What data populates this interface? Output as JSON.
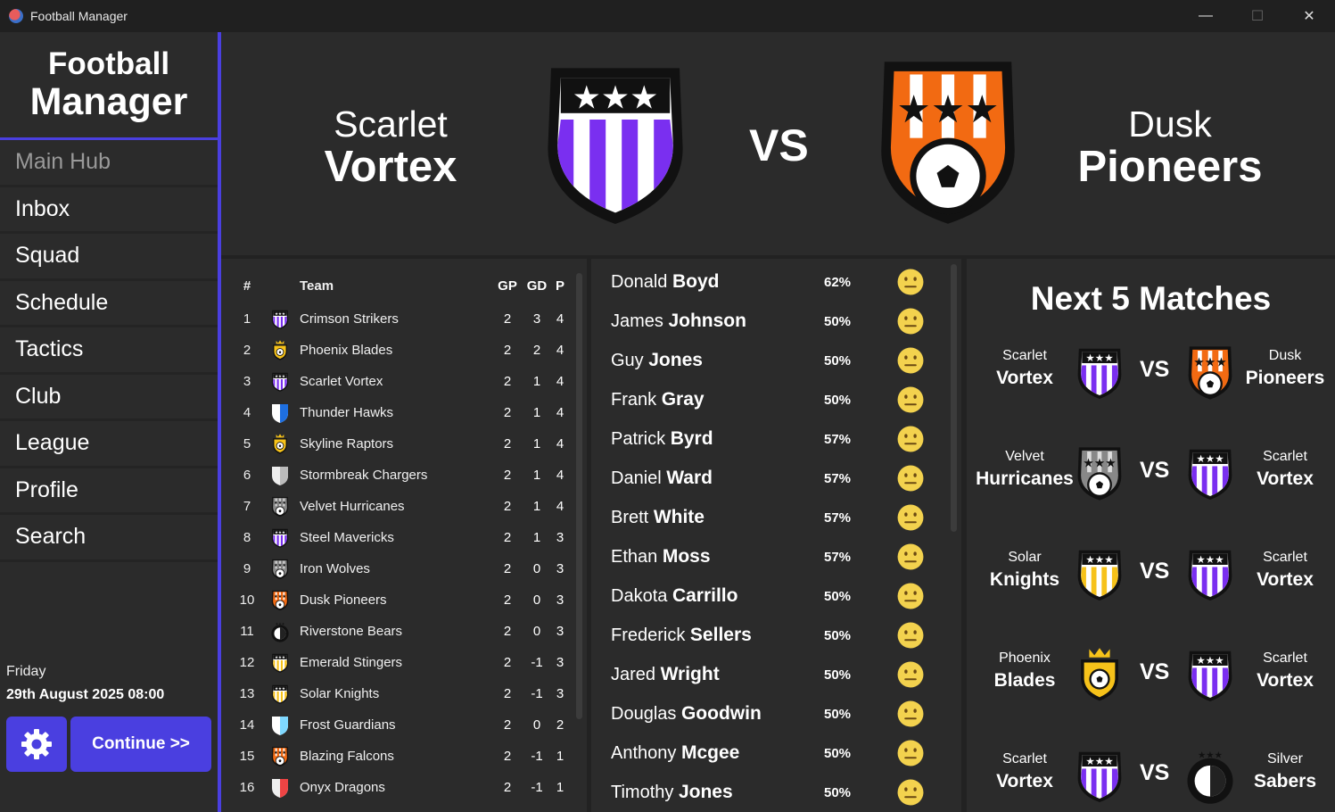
{
  "window": {
    "title": "Football Manager",
    "minimize": "—",
    "maximize": "☐",
    "close": "✕"
  },
  "brand": {
    "line1": "Football",
    "line2": "Manager"
  },
  "nav": [
    {
      "label": "Main Hub",
      "active": true
    },
    {
      "label": "Inbox"
    },
    {
      "label": "Squad"
    },
    {
      "label": "Schedule"
    },
    {
      "label": "Tactics"
    },
    {
      "label": "Club"
    },
    {
      "label": "League"
    },
    {
      "label": "Profile"
    },
    {
      "label": "Search"
    }
  ],
  "datetime": {
    "day": "Friday",
    "date": "29th August 2025 08:00"
  },
  "continue_label": "Continue >>",
  "header": {
    "home": {
      "first": "Scarlet",
      "last": "Vortex"
    },
    "vs": "VS",
    "away": {
      "first": "Dusk",
      "last": "Pioneers"
    }
  },
  "standings": {
    "columns": {
      "pos": "#",
      "team": "Team",
      "gp": "GP",
      "gd": "GD",
      "p": "P"
    },
    "rows": [
      {
        "pos": "1",
        "team": "Crimson Strikers",
        "gp": "2",
        "gd": "3",
        "p": "4",
        "badge": "crimson-strikers-crest-icon"
      },
      {
        "pos": "2",
        "team": "Phoenix Blades",
        "gp": "2",
        "gd": "2",
        "p": "4",
        "badge": "phoenix-blades-crest-icon"
      },
      {
        "pos": "3",
        "team": "Scarlet Vortex",
        "gp": "2",
        "gd": "1",
        "p": "4",
        "badge": "scarlet-vortex-crest-icon"
      },
      {
        "pos": "4",
        "team": "Thunder Hawks",
        "gp": "2",
        "gd": "1",
        "p": "4",
        "badge": "thunder-hawks-crest-icon"
      },
      {
        "pos": "5",
        "team": "Skyline Raptors",
        "gp": "2",
        "gd": "1",
        "p": "4",
        "badge": "skyline-raptors-crest-icon"
      },
      {
        "pos": "6",
        "team": "Stormbreak Chargers",
        "gp": "2",
        "gd": "1",
        "p": "4",
        "badge": "stormbreak-chargers-crest-icon"
      },
      {
        "pos": "7",
        "team": "Velvet Hurricanes",
        "gp": "2",
        "gd": "1",
        "p": "4",
        "badge": "velvet-hurricanes-crest-icon"
      },
      {
        "pos": "8",
        "team": "Steel Mavericks",
        "gp": "2",
        "gd": "1",
        "p": "3",
        "badge": "steel-mavericks-crest-icon"
      },
      {
        "pos": "9",
        "team": "Iron Wolves",
        "gp": "2",
        "gd": "0",
        "p": "3",
        "badge": "iron-wolves-crest-icon"
      },
      {
        "pos": "10",
        "team": "Dusk Pioneers",
        "gp": "2",
        "gd": "0",
        "p": "3",
        "badge": "dusk-pioneers-crest-icon"
      },
      {
        "pos": "11",
        "team": "Riverstone Bears",
        "gp": "2",
        "gd": "0",
        "p": "3",
        "badge": "riverstone-bears-crest-icon"
      },
      {
        "pos": "12",
        "team": "Emerald Stingers",
        "gp": "2",
        "gd": "-1",
        "p": "3",
        "badge": "emerald-stingers-crest-icon"
      },
      {
        "pos": "13",
        "team": "Solar Knights",
        "gp": "2",
        "gd": "-1",
        "p": "3",
        "badge": "solar-knights-crest-icon"
      },
      {
        "pos": "14",
        "team": "Frost Guardians",
        "gp": "2",
        "gd": "0",
        "p": "2",
        "badge": "frost-guardians-crest-icon"
      },
      {
        "pos": "15",
        "team": "Blazing Falcons",
        "gp": "2",
        "gd": "-1",
        "p": "1",
        "badge": "blazing-falcons-crest-icon"
      },
      {
        "pos": "16",
        "team": "Onyx Dragons",
        "gp": "2",
        "gd": "-1",
        "p": "1",
        "badge": "onyx-dragons-crest-icon"
      }
    ]
  },
  "players": [
    {
      "first": "Donald",
      "last": "Boyd",
      "pct": "62%"
    },
    {
      "first": "James",
      "last": "Johnson",
      "pct": "50%"
    },
    {
      "first": "Guy",
      "last": "Jones",
      "pct": "50%"
    },
    {
      "first": "Frank",
      "last": "Gray",
      "pct": "50%"
    },
    {
      "first": "Patrick",
      "last": "Byrd",
      "pct": "57%"
    },
    {
      "first": "Daniel",
      "last": "Ward",
      "pct": "57%"
    },
    {
      "first": "Brett",
      "last": "White",
      "pct": "57%"
    },
    {
      "first": "Ethan",
      "last": "Moss",
      "pct": "57%"
    },
    {
      "first": "Dakota",
      "last": "Carrillo",
      "pct": "50%"
    },
    {
      "first": "Frederick",
      "last": "Sellers",
      "pct": "50%"
    },
    {
      "first": "Jared",
      "last": "Wright",
      "pct": "50%"
    },
    {
      "first": "Douglas",
      "last": "Goodwin",
      "pct": "50%"
    },
    {
      "first": "Anthony",
      "last": "Mcgee",
      "pct": "50%"
    },
    {
      "first": "Timothy",
      "last": "Jones",
      "pct": "50%"
    }
  ],
  "next_matches": {
    "title": "Next 5 Matches",
    "matches": [
      {
        "home_first": "Scarlet",
        "home_last": "Vortex",
        "away_first": "Dusk",
        "away_last": "Pioneers",
        "vs": "VS"
      },
      {
        "home_first": "Velvet",
        "home_last": "Hurricanes",
        "away_first": "Scarlet",
        "away_last": "Vortex",
        "vs": "VS"
      },
      {
        "home_first": "Solar",
        "home_last": "Knights",
        "away_first": "Scarlet",
        "away_last": "Vortex",
        "vs": "VS"
      },
      {
        "home_first": "Phoenix",
        "home_last": "Blades",
        "away_first": "Scarlet",
        "away_last": "Vortex",
        "vs": "VS"
      },
      {
        "home_first": "Scarlet",
        "home_last": "Vortex",
        "away_first": "Silver",
        "away_last": "Sabers",
        "vs": "VS"
      }
    ]
  },
  "colors": {
    "accent": "#4a3fe0",
    "purple_stripe": "#7a2ff0",
    "orange": "#f26a12",
    "gold": "#f6c21a",
    "face": "#f3d24e"
  }
}
